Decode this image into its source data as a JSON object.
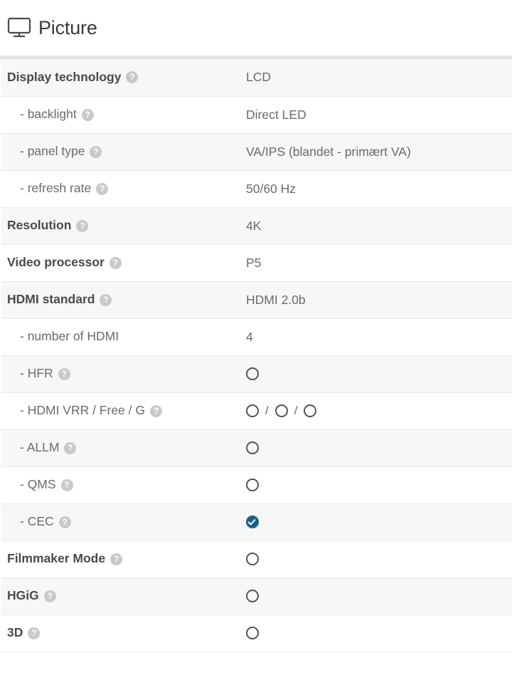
{
  "header": {
    "icon": "monitor-icon",
    "title": "Picture"
  },
  "colors": {
    "check_blue": "#17638c",
    "row_shaded": "#f7f7f7",
    "row_plain": "#ffffff",
    "help_badge": "#c9c9c9",
    "label_top": "#4a4a4a",
    "label_sub": "#6a6a6a"
  },
  "help_glyph": "?",
  "separator": "/",
  "rows": [
    {
      "label": "Display technology",
      "level": "top",
      "help": true,
      "value_type": "text",
      "value": "LCD",
      "shaded": true
    },
    {
      "label": "- backlight",
      "level": "sub",
      "help": true,
      "value_type": "text",
      "value": "Direct LED",
      "shaded": false
    },
    {
      "label": "- panel type",
      "level": "sub",
      "help": true,
      "value_type": "text",
      "value": "VA/IPS (blandet - primært VA)",
      "shaded": true
    },
    {
      "label": "- refresh rate",
      "level": "sub",
      "help": true,
      "value_type": "text",
      "value": "50/60 Hz",
      "shaded": false
    },
    {
      "label": "Resolution",
      "level": "top",
      "help": true,
      "value_type": "text",
      "value": "4K",
      "shaded": true
    },
    {
      "label": "Video processor",
      "level": "top",
      "help": true,
      "value_type": "text",
      "value": "P5",
      "shaded": false
    },
    {
      "label": "HDMI standard",
      "level": "top",
      "help": true,
      "value_type": "text",
      "value": "HDMI 2.0b",
      "shaded": true
    },
    {
      "label": "- number of HDMI",
      "level": "sub",
      "help": false,
      "value_type": "text",
      "value": "4",
      "shaded": false
    },
    {
      "label": "- HFR",
      "level": "sub",
      "help": true,
      "value_type": "marks",
      "marks": [
        "no"
      ],
      "shaded": true
    },
    {
      "label": "- HDMI VRR / Free / G",
      "level": "sub",
      "help": true,
      "value_type": "marks",
      "marks": [
        "no",
        "no",
        "no"
      ],
      "shaded": false
    },
    {
      "label": "- ALLM",
      "level": "sub",
      "help": true,
      "value_type": "marks",
      "marks": [
        "no"
      ],
      "shaded": true
    },
    {
      "label": "- QMS",
      "level": "sub",
      "help": true,
      "value_type": "marks",
      "marks": [
        "no"
      ],
      "shaded": false
    },
    {
      "label": "- CEC",
      "level": "sub",
      "help": true,
      "value_type": "marks",
      "marks": [
        "yes"
      ],
      "shaded": true
    },
    {
      "label": "Filmmaker Mode",
      "level": "top",
      "help": true,
      "value_type": "marks",
      "marks": [
        "no"
      ],
      "shaded": false
    },
    {
      "label": "HGiG",
      "level": "top",
      "help": true,
      "value_type": "marks",
      "marks": [
        "no"
      ],
      "shaded": true
    },
    {
      "label": "3D",
      "level": "top",
      "help": true,
      "value_type": "marks",
      "marks": [
        "no"
      ],
      "shaded": false
    }
  ]
}
